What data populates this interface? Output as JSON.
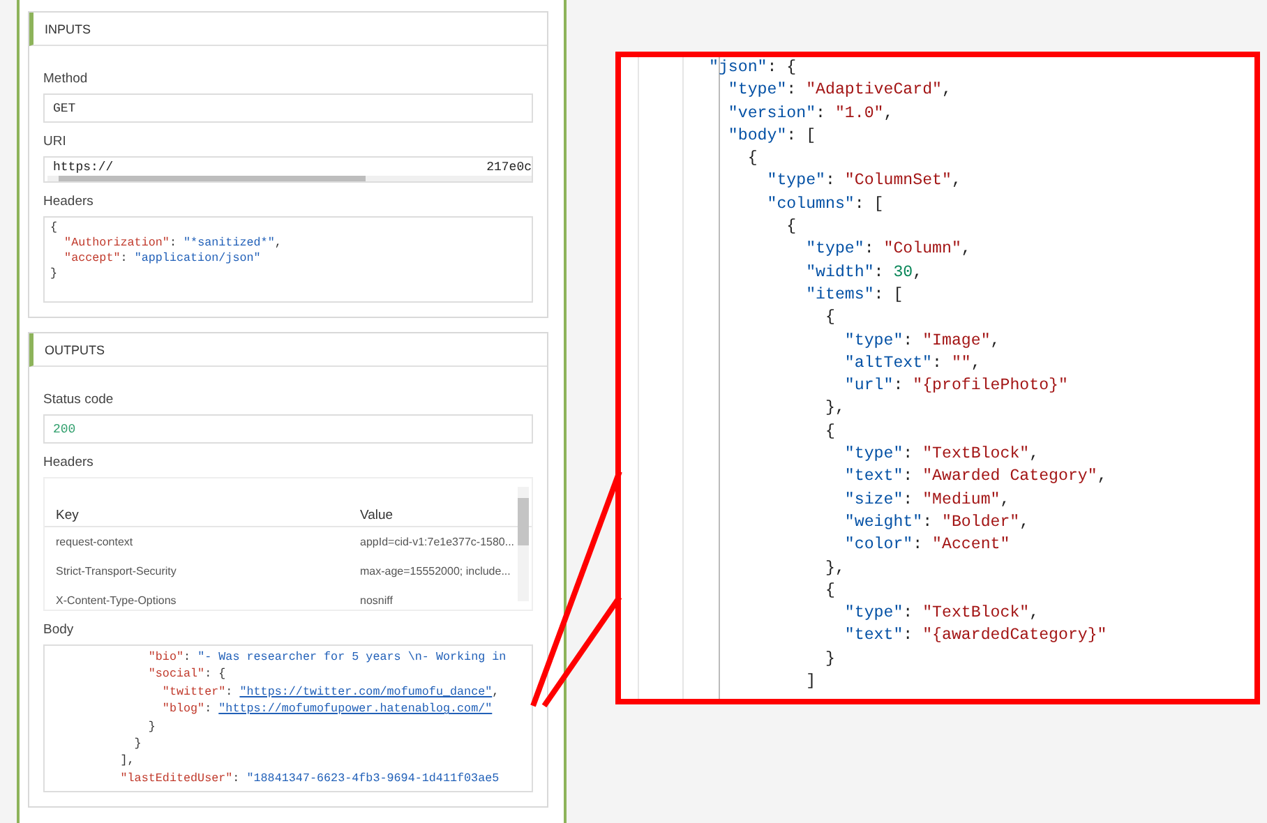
{
  "inputs": {
    "title": "INPUTS",
    "fields": [
      {
        "kind": "text",
        "label": "Method",
        "value": "GET"
      },
      {
        "kind": "uri",
        "label": "URI",
        "value_start": "https://",
        "value_end": "217e0c"
      },
      {
        "kind": "code",
        "label": "Headers",
        "lines": [
          {
            "tokens": [
              {
                "kind": "punct",
                "text": "{"
              }
            ]
          },
          {
            "tokens": [
              {
                "kind": "key",
                "text": "  \"Authorization\""
              },
              {
                "kind": "punct",
                "text": ": "
              },
              {
                "kind": "string",
                "text": "\"*sanitized*\""
              },
              {
                "kind": "punct",
                "text": ","
              }
            ]
          },
          {
            "tokens": [
              {
                "kind": "key",
                "text": "  \"accept\""
              },
              {
                "kind": "punct",
                "text": ": "
              },
              {
                "kind": "string",
                "text": "\"application/json\""
              }
            ]
          },
          {
            "tokens": [
              {
                "kind": "punct",
                "text": "}"
              }
            ]
          }
        ]
      }
    ]
  },
  "outputs": {
    "title": "OUTPUTS",
    "fields": [
      {
        "kind": "number",
        "label": "Status code",
        "value": "200"
      },
      {
        "kind": "table",
        "label": "Headers",
        "columns": [
          "Key",
          "Value"
        ],
        "rows": [
          [
            "request-context",
            "appId=cid-v1:7e1e377c-1580..."
          ],
          [
            "Strict-Transport-Security",
            "max-age=15552000; include..."
          ],
          [
            "X-Content-Type-Options",
            "nosniff"
          ]
        ]
      },
      {
        "kind": "code",
        "label": "Body",
        "lines": [
          {
            "tokens": [
              {
                "kind": "key",
                "text": "              \"bio\""
              },
              {
                "kind": "punct",
                "text": ": "
              },
              {
                "kind": "string",
                "text": "\"- Was researcher for 5 years \\n- Working in"
              }
            ]
          },
          {
            "tokens": [
              {
                "kind": "key",
                "text": "              \"social\""
              },
              {
                "kind": "punct",
                "text": ": {"
              }
            ]
          },
          {
            "tokens": [
              {
                "kind": "key",
                "text": "                \"twitter\""
              },
              {
                "kind": "punct",
                "text": ": "
              },
              {
                "kind": "link",
                "text": "\"https://twitter.com/mofumofu_dance\""
              },
              {
                "kind": "punct",
                "text": ","
              }
            ]
          },
          {
            "tokens": [
              {
                "kind": "key",
                "text": "                \"blog\""
              },
              {
                "kind": "punct",
                "text": ": "
              },
              {
                "kind": "link",
                "text": "\"https://mofumofupower.hatenablog.com/\""
              }
            ]
          },
          {
            "tokens": [
              {
                "kind": "punct",
                "text": "              }"
              }
            ]
          },
          {
            "tokens": [
              {
                "kind": "punct",
                "text": "            }"
              }
            ]
          },
          {
            "tokens": [
              {
                "kind": "punct",
                "text": "          ],"
              }
            ]
          },
          {
            "tokens": [
              {
                "kind": "key",
                "text": "          \"lastEditedUser\""
              },
              {
                "kind": "punct",
                "text": ": "
              },
              {
                "kind": "string",
                "text": "\"18841347-6623-4fb3-9694-1d411f03ae5"
              }
            ]
          }
        ]
      }
    ]
  },
  "callout": {
    "lines": [
      {
        "tokens": [
          {
            "kind": "key",
            "text": "\"json\""
          },
          {
            "kind": "punct",
            "text": ": {"
          }
        ]
      },
      {
        "tokens": [
          {
            "kind": "key",
            "text": "  \"type\""
          },
          {
            "kind": "punct",
            "text": ": "
          },
          {
            "kind": "string",
            "text": "\"AdaptiveCard\""
          },
          {
            "kind": "punct",
            "text": ","
          }
        ]
      },
      {
        "tokens": [
          {
            "kind": "key",
            "text": "  \"version\""
          },
          {
            "kind": "punct",
            "text": ": "
          },
          {
            "kind": "string",
            "text": "\"1.0\""
          },
          {
            "kind": "punct",
            "text": ","
          }
        ]
      },
      {
        "tokens": [
          {
            "kind": "key",
            "text": "  \"body\""
          },
          {
            "kind": "punct",
            "text": ": ["
          }
        ]
      },
      {
        "tokens": [
          {
            "kind": "punct",
            "text": "    {"
          }
        ]
      },
      {
        "tokens": [
          {
            "kind": "key",
            "text": "      \"type\""
          },
          {
            "kind": "punct",
            "text": ": "
          },
          {
            "kind": "string",
            "text": "\"ColumnSet\""
          },
          {
            "kind": "punct",
            "text": ","
          }
        ]
      },
      {
        "tokens": [
          {
            "kind": "key",
            "text": "      \"columns\""
          },
          {
            "kind": "punct",
            "text": ": ["
          }
        ]
      },
      {
        "tokens": [
          {
            "kind": "punct",
            "text": "        {"
          }
        ]
      },
      {
        "tokens": [
          {
            "kind": "key",
            "text": "          \"type\""
          },
          {
            "kind": "punct",
            "text": ": "
          },
          {
            "kind": "string",
            "text": "\"Column\""
          },
          {
            "kind": "punct",
            "text": ","
          }
        ]
      },
      {
        "tokens": [
          {
            "kind": "key",
            "text": "          \"width\""
          },
          {
            "kind": "punct",
            "text": ": "
          },
          {
            "kind": "number",
            "text": "30"
          },
          {
            "kind": "punct",
            "text": ","
          }
        ]
      },
      {
        "tokens": [
          {
            "kind": "key",
            "text": "          \"items\""
          },
          {
            "kind": "punct",
            "text": ": ["
          }
        ]
      },
      {
        "tokens": [
          {
            "kind": "punct",
            "text": "            {"
          }
        ]
      },
      {
        "tokens": [
          {
            "kind": "key",
            "text": "              \"type\""
          },
          {
            "kind": "punct",
            "text": ": "
          },
          {
            "kind": "string",
            "text": "\"Image\""
          },
          {
            "kind": "punct",
            "text": ","
          }
        ]
      },
      {
        "tokens": [
          {
            "kind": "key",
            "text": "              \"altText\""
          },
          {
            "kind": "punct",
            "text": ": "
          },
          {
            "kind": "string",
            "text": "\"\""
          },
          {
            "kind": "punct",
            "text": ","
          }
        ]
      },
      {
        "tokens": [
          {
            "kind": "key",
            "text": "              \"url\""
          },
          {
            "kind": "punct",
            "text": ": "
          },
          {
            "kind": "string",
            "text": "\"{profilePhoto}\""
          }
        ]
      },
      {
        "tokens": [
          {
            "kind": "punct",
            "text": "            },"
          }
        ]
      },
      {
        "tokens": [
          {
            "kind": "punct",
            "text": "            {"
          }
        ]
      },
      {
        "tokens": [
          {
            "kind": "key",
            "text": "              \"type\""
          },
          {
            "kind": "punct",
            "text": ": "
          },
          {
            "kind": "string",
            "text": "\"TextBlock\""
          },
          {
            "kind": "punct",
            "text": ","
          }
        ]
      },
      {
        "tokens": [
          {
            "kind": "key",
            "text": "              \"text\""
          },
          {
            "kind": "punct",
            "text": ": "
          },
          {
            "kind": "string",
            "text": "\"Awarded Category\""
          },
          {
            "kind": "punct",
            "text": ","
          }
        ]
      },
      {
        "tokens": [
          {
            "kind": "key",
            "text": "              \"size\""
          },
          {
            "kind": "punct",
            "text": ": "
          },
          {
            "kind": "string",
            "text": "\"Medium\""
          },
          {
            "kind": "punct",
            "text": ","
          }
        ]
      },
      {
        "tokens": [
          {
            "kind": "key",
            "text": "              \"weight\""
          },
          {
            "kind": "punct",
            "text": ": "
          },
          {
            "kind": "string",
            "text": "\"Bolder\""
          },
          {
            "kind": "punct",
            "text": ","
          }
        ]
      },
      {
        "tokens": [
          {
            "kind": "key",
            "text": "              \"color\""
          },
          {
            "kind": "punct",
            "text": ": "
          },
          {
            "kind": "string",
            "text": "\"Accent\""
          }
        ]
      },
      {
        "tokens": [
          {
            "kind": "punct",
            "text": "            },"
          }
        ]
      },
      {
        "tokens": [
          {
            "kind": "punct",
            "text": "            {"
          }
        ]
      },
      {
        "tokens": [
          {
            "kind": "key",
            "text": "              \"type\""
          },
          {
            "kind": "punct",
            "text": ": "
          },
          {
            "kind": "string",
            "text": "\"TextBlock\""
          },
          {
            "kind": "punct",
            "text": ","
          }
        ]
      },
      {
        "tokens": [
          {
            "kind": "key",
            "text": "              \"text\""
          },
          {
            "kind": "punct",
            "text": ": "
          },
          {
            "kind": "string",
            "text": "\"{awardedCategory}\""
          }
        ]
      },
      {
        "tokens": [
          {
            "kind": "punct",
            "text": "            }"
          }
        ]
      },
      {
        "tokens": [
          {
            "kind": "punct",
            "text": "          ]"
          }
        ]
      }
    ]
  }
}
